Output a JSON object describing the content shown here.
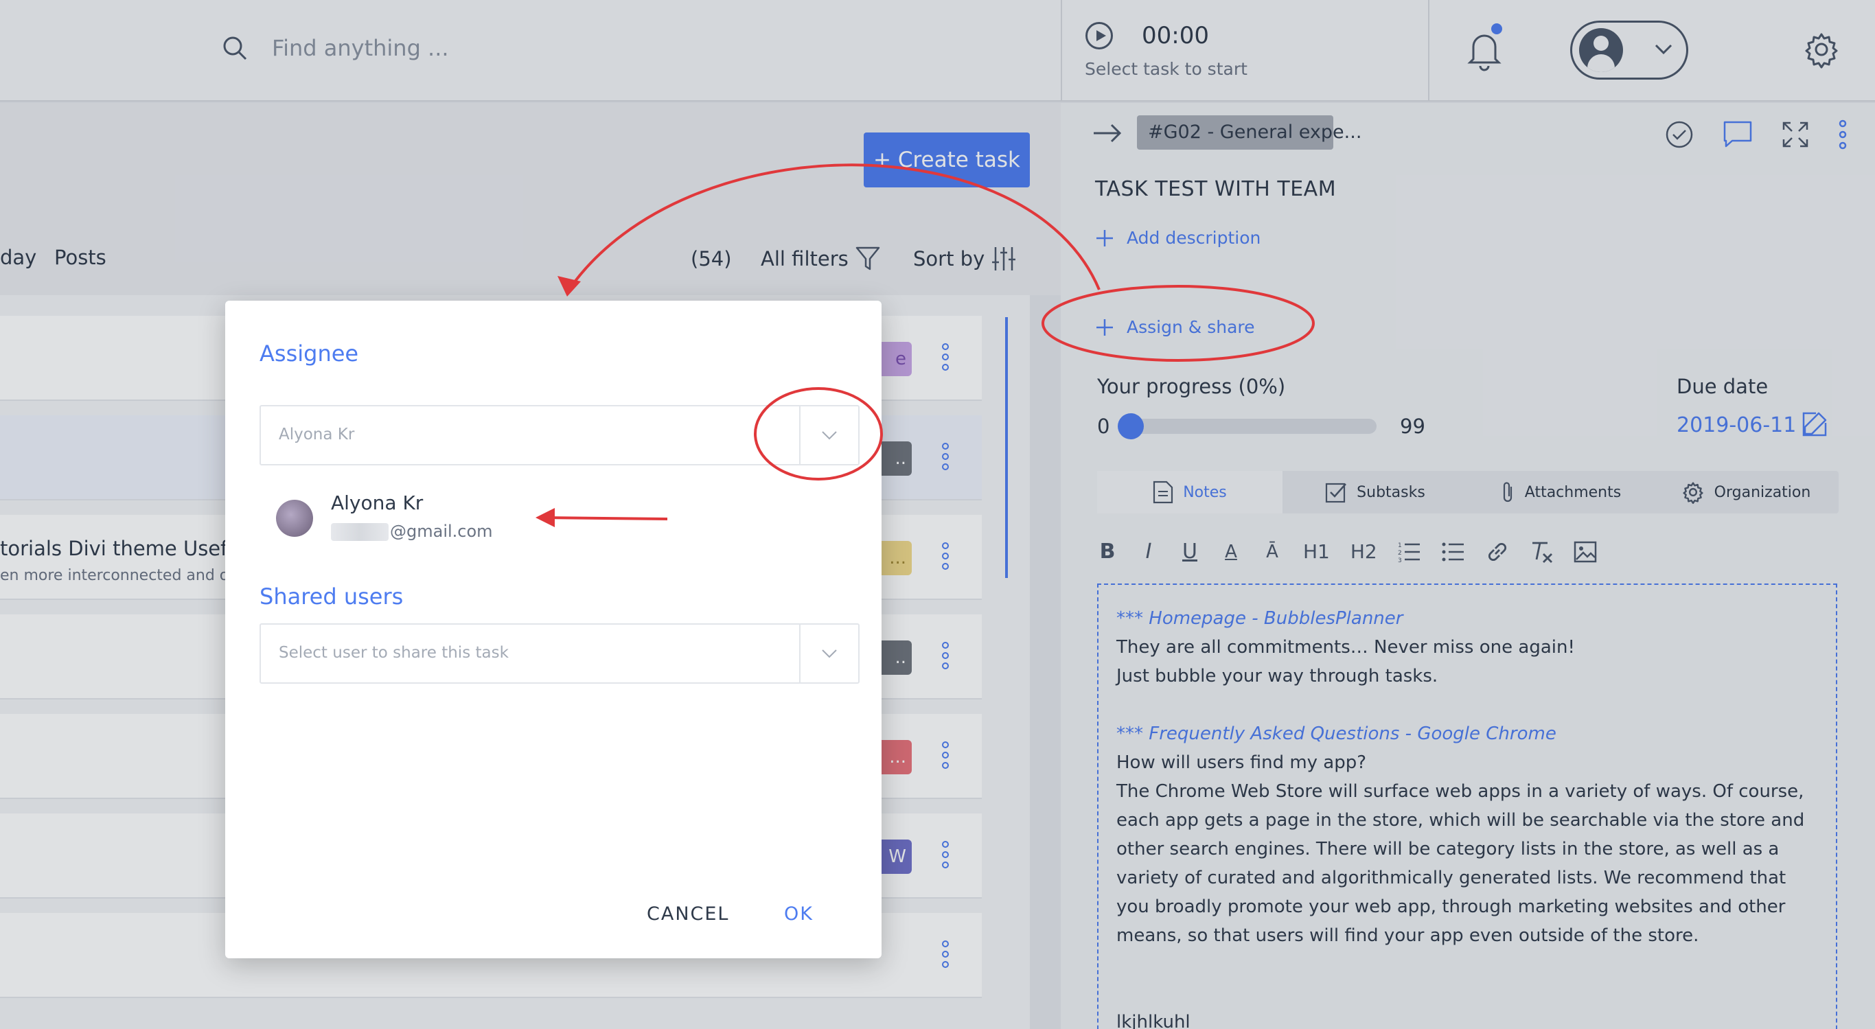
{
  "search": {
    "placeholder": "Find anything ..."
  },
  "timer": {
    "time": "00:00",
    "hint": "Select task to start"
  },
  "list": {
    "create_label": "+ Create task",
    "tabs": [
      "day",
      "Posts"
    ],
    "count": "(54)",
    "filters_label": "All filters",
    "sort_label": "Sort by",
    "partial_row_title": "torials Divi theme Useful",
    "partial_row_sub": "en more interconnected and o",
    "tag_glyphs": [
      "e",
      "..",
      "...",
      "..",
      "...",
      "W",
      ""
    ]
  },
  "task": {
    "chip": "#G02 - General expe...",
    "title": "TASK TEST WITH TEAM",
    "add_description": "Add description",
    "assign_share": "Assign & share",
    "progress_label": "Your progress  (0%)",
    "progress_value": 0,
    "progress_min": "0",
    "progress_max": "99",
    "due_label": "Due date",
    "due_value": "2019-06-11",
    "tabs": [
      "Notes",
      "Subtasks",
      "Attachments",
      "Organization"
    ],
    "toolbar": [
      "B",
      "I",
      "U",
      "A",
      "Ā",
      "H1",
      "H2"
    ],
    "notes": {
      "link1": "*** Homepage - BubblesPlanner",
      "line1": "They are all commitments… Never miss one again!",
      "line2": "Just bubble your way through tasks.",
      "link2": "*** Frequently Asked Questions - Google Chrome",
      "line3": "How will users find my app?",
      "para": "The Chrome Web Store will surface web apps in a variety of ways. Of course, each app gets a page in the store, which will be searchable via the store and other search engines. There will be category lists in the store, as well as a variety of curated and algorithmically generated lists. We recommend that you broadly promote your web app, through marketing websites and other means, so that users will find your app even outside of the store.",
      "tail": "lkjhlkuhl"
    }
  },
  "dialog": {
    "assignee_heading": "Assignee",
    "assignee_value": "Alyona Kr",
    "option_name": "Alyona Kr",
    "option_email": "@gmail.com",
    "shared_heading": "Shared users",
    "shared_placeholder": "Select user to share this task",
    "cancel_label": "CANCEL",
    "ok_label": "OK"
  },
  "colors": {
    "accent": "#4d7cf0",
    "annotation": "#e0383b"
  },
  "icons": [
    "search-icon",
    "play-icon",
    "bell-icon",
    "user-icon",
    "chevron-down-icon",
    "gear-icon",
    "filter-icon",
    "sort-icon",
    "arrow-right-icon",
    "check-circle-icon",
    "comment-icon",
    "expand-icon",
    "more-icon",
    "plus-icon",
    "edit-icon",
    "notes-icon",
    "subtasks-icon",
    "attachment-icon"
  ]
}
